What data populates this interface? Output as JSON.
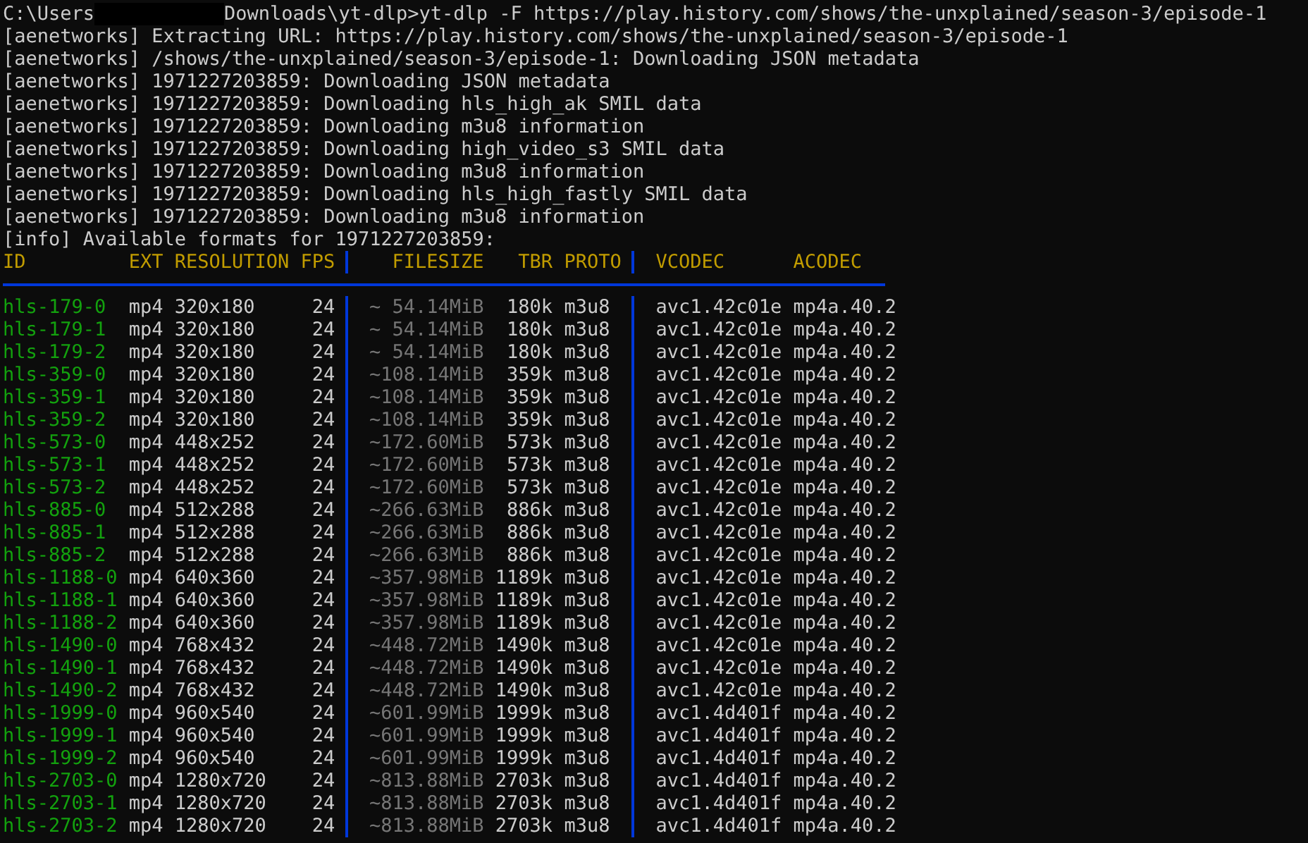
{
  "prompt": {
    "path": "C:\\Users",
    "command": "Downloads\\yt-dlp>yt-dlp -F https://play.history.com/shows/the-unxplained/season-3/episode-1"
  },
  "log_lines": [
    "[aenetworks] Extracting URL: https://play.history.com/shows/the-unxplained/season-3/episode-1",
    "[aenetworks] /shows/the-unxplained/season-3/episode-1: Downloading JSON metadata",
    "[aenetworks] 1971227203859: Downloading JSON metadata",
    "[aenetworks] 1971227203859: Downloading hls_high_ak SMIL data",
    "[aenetworks] 1971227203859: Downloading m3u8 information",
    "[aenetworks] 1971227203859: Downloading high_video_s3 SMIL data",
    "[aenetworks] 1971227203859: Downloading m3u8 information",
    "[aenetworks] 1971227203859: Downloading hls_high_fastly SMIL data",
    "[aenetworks] 1971227203859: Downloading m3u8 information",
    "[info] Available formats for 1971227203859:"
  ],
  "table": {
    "columns": [
      "ID",
      "EXT",
      "RESOLUTION",
      "FPS",
      "FILESIZE",
      "TBR",
      "PROTO",
      "VCODEC",
      "ACODEC"
    ],
    "rows": [
      {
        "id": "hls-179-0",
        "ext": "mp4",
        "resolution": "320x180",
        "fps": "24",
        "filesize": "~ 54.14MiB",
        "tbr": "180k",
        "proto": "m3u8",
        "vcodec": "avc1.42c01e",
        "acodec": "mp4a.40.2"
      },
      {
        "id": "hls-179-1",
        "ext": "mp4",
        "resolution": "320x180",
        "fps": "24",
        "filesize": "~ 54.14MiB",
        "tbr": "180k",
        "proto": "m3u8",
        "vcodec": "avc1.42c01e",
        "acodec": "mp4a.40.2"
      },
      {
        "id": "hls-179-2",
        "ext": "mp4",
        "resolution": "320x180",
        "fps": "24",
        "filesize": "~ 54.14MiB",
        "tbr": "180k",
        "proto": "m3u8",
        "vcodec": "avc1.42c01e",
        "acodec": "mp4a.40.2"
      },
      {
        "id": "hls-359-0",
        "ext": "mp4",
        "resolution": "320x180",
        "fps": "24",
        "filesize": "~108.14MiB",
        "tbr": "359k",
        "proto": "m3u8",
        "vcodec": "avc1.42c01e",
        "acodec": "mp4a.40.2"
      },
      {
        "id": "hls-359-1",
        "ext": "mp4",
        "resolution": "320x180",
        "fps": "24",
        "filesize": "~108.14MiB",
        "tbr": "359k",
        "proto": "m3u8",
        "vcodec": "avc1.42c01e",
        "acodec": "mp4a.40.2"
      },
      {
        "id": "hls-359-2",
        "ext": "mp4",
        "resolution": "320x180",
        "fps": "24",
        "filesize": "~108.14MiB",
        "tbr": "359k",
        "proto": "m3u8",
        "vcodec": "avc1.42c01e",
        "acodec": "mp4a.40.2"
      },
      {
        "id": "hls-573-0",
        "ext": "mp4",
        "resolution": "448x252",
        "fps": "24",
        "filesize": "~172.60MiB",
        "tbr": "573k",
        "proto": "m3u8",
        "vcodec": "avc1.42c01e",
        "acodec": "mp4a.40.2"
      },
      {
        "id": "hls-573-1",
        "ext": "mp4",
        "resolution": "448x252",
        "fps": "24",
        "filesize": "~172.60MiB",
        "tbr": "573k",
        "proto": "m3u8",
        "vcodec": "avc1.42c01e",
        "acodec": "mp4a.40.2"
      },
      {
        "id": "hls-573-2",
        "ext": "mp4",
        "resolution": "448x252",
        "fps": "24",
        "filesize": "~172.60MiB",
        "tbr": "573k",
        "proto": "m3u8",
        "vcodec": "avc1.42c01e",
        "acodec": "mp4a.40.2"
      },
      {
        "id": "hls-885-0",
        "ext": "mp4",
        "resolution": "512x288",
        "fps": "24",
        "filesize": "~266.63MiB",
        "tbr": "886k",
        "proto": "m3u8",
        "vcodec": "avc1.42c01e",
        "acodec": "mp4a.40.2"
      },
      {
        "id": "hls-885-1",
        "ext": "mp4",
        "resolution": "512x288",
        "fps": "24",
        "filesize": "~266.63MiB",
        "tbr": "886k",
        "proto": "m3u8",
        "vcodec": "avc1.42c01e",
        "acodec": "mp4a.40.2"
      },
      {
        "id": "hls-885-2",
        "ext": "mp4",
        "resolution": "512x288",
        "fps": "24",
        "filesize": "~266.63MiB",
        "tbr": "886k",
        "proto": "m3u8",
        "vcodec": "avc1.42c01e",
        "acodec": "mp4a.40.2"
      },
      {
        "id": "hls-1188-0",
        "ext": "mp4",
        "resolution": "640x360",
        "fps": "24",
        "filesize": "~357.98MiB",
        "tbr": "1189k",
        "proto": "m3u8",
        "vcodec": "avc1.42c01e",
        "acodec": "mp4a.40.2"
      },
      {
        "id": "hls-1188-1",
        "ext": "mp4",
        "resolution": "640x360",
        "fps": "24",
        "filesize": "~357.98MiB",
        "tbr": "1189k",
        "proto": "m3u8",
        "vcodec": "avc1.42c01e",
        "acodec": "mp4a.40.2"
      },
      {
        "id": "hls-1188-2",
        "ext": "mp4",
        "resolution": "640x360",
        "fps": "24",
        "filesize": "~357.98MiB",
        "tbr": "1189k",
        "proto": "m3u8",
        "vcodec": "avc1.42c01e",
        "acodec": "mp4a.40.2"
      },
      {
        "id": "hls-1490-0",
        "ext": "mp4",
        "resolution": "768x432",
        "fps": "24",
        "filesize": "~448.72MiB",
        "tbr": "1490k",
        "proto": "m3u8",
        "vcodec": "avc1.42c01e",
        "acodec": "mp4a.40.2"
      },
      {
        "id": "hls-1490-1",
        "ext": "mp4",
        "resolution": "768x432",
        "fps": "24",
        "filesize": "~448.72MiB",
        "tbr": "1490k",
        "proto": "m3u8",
        "vcodec": "avc1.42c01e",
        "acodec": "mp4a.40.2"
      },
      {
        "id": "hls-1490-2",
        "ext": "mp4",
        "resolution": "768x432",
        "fps": "24",
        "filesize": "~448.72MiB",
        "tbr": "1490k",
        "proto": "m3u8",
        "vcodec": "avc1.42c01e",
        "acodec": "mp4a.40.2"
      },
      {
        "id": "hls-1999-0",
        "ext": "mp4",
        "resolution": "960x540",
        "fps": "24",
        "filesize": "~601.99MiB",
        "tbr": "1999k",
        "proto": "m3u8",
        "vcodec": "avc1.4d401f",
        "acodec": "mp4a.40.2"
      },
      {
        "id": "hls-1999-1",
        "ext": "mp4",
        "resolution": "960x540",
        "fps": "24",
        "filesize": "~601.99MiB",
        "tbr": "1999k",
        "proto": "m3u8",
        "vcodec": "avc1.4d401f",
        "acodec": "mp4a.40.2"
      },
      {
        "id": "hls-1999-2",
        "ext": "mp4",
        "resolution": "960x540",
        "fps": "24",
        "filesize": "~601.99MiB",
        "tbr": "1999k",
        "proto": "m3u8",
        "vcodec": "avc1.4d401f",
        "acodec": "mp4a.40.2"
      },
      {
        "id": "hls-2703-0",
        "ext": "mp4",
        "resolution": "1280x720",
        "fps": "24",
        "filesize": "~813.88MiB",
        "tbr": "2703k",
        "proto": "m3u8",
        "vcodec": "avc1.4d401f",
        "acodec": "mp4a.40.2"
      },
      {
        "id": "hls-2703-1",
        "ext": "mp4",
        "resolution": "1280x720",
        "fps": "24",
        "filesize": "~813.88MiB",
        "tbr": "2703k",
        "proto": "m3u8",
        "vcodec": "avc1.4d401f",
        "acodec": "mp4a.40.2"
      },
      {
        "id": "hls-2703-2",
        "ext": "mp4",
        "resolution": "1280x720",
        "fps": "24",
        "filesize": "~813.88MiB",
        "tbr": "2703k",
        "proto": "m3u8",
        "vcodec": "avc1.4d401f",
        "acodec": "mp4a.40.2"
      }
    ]
  }
}
